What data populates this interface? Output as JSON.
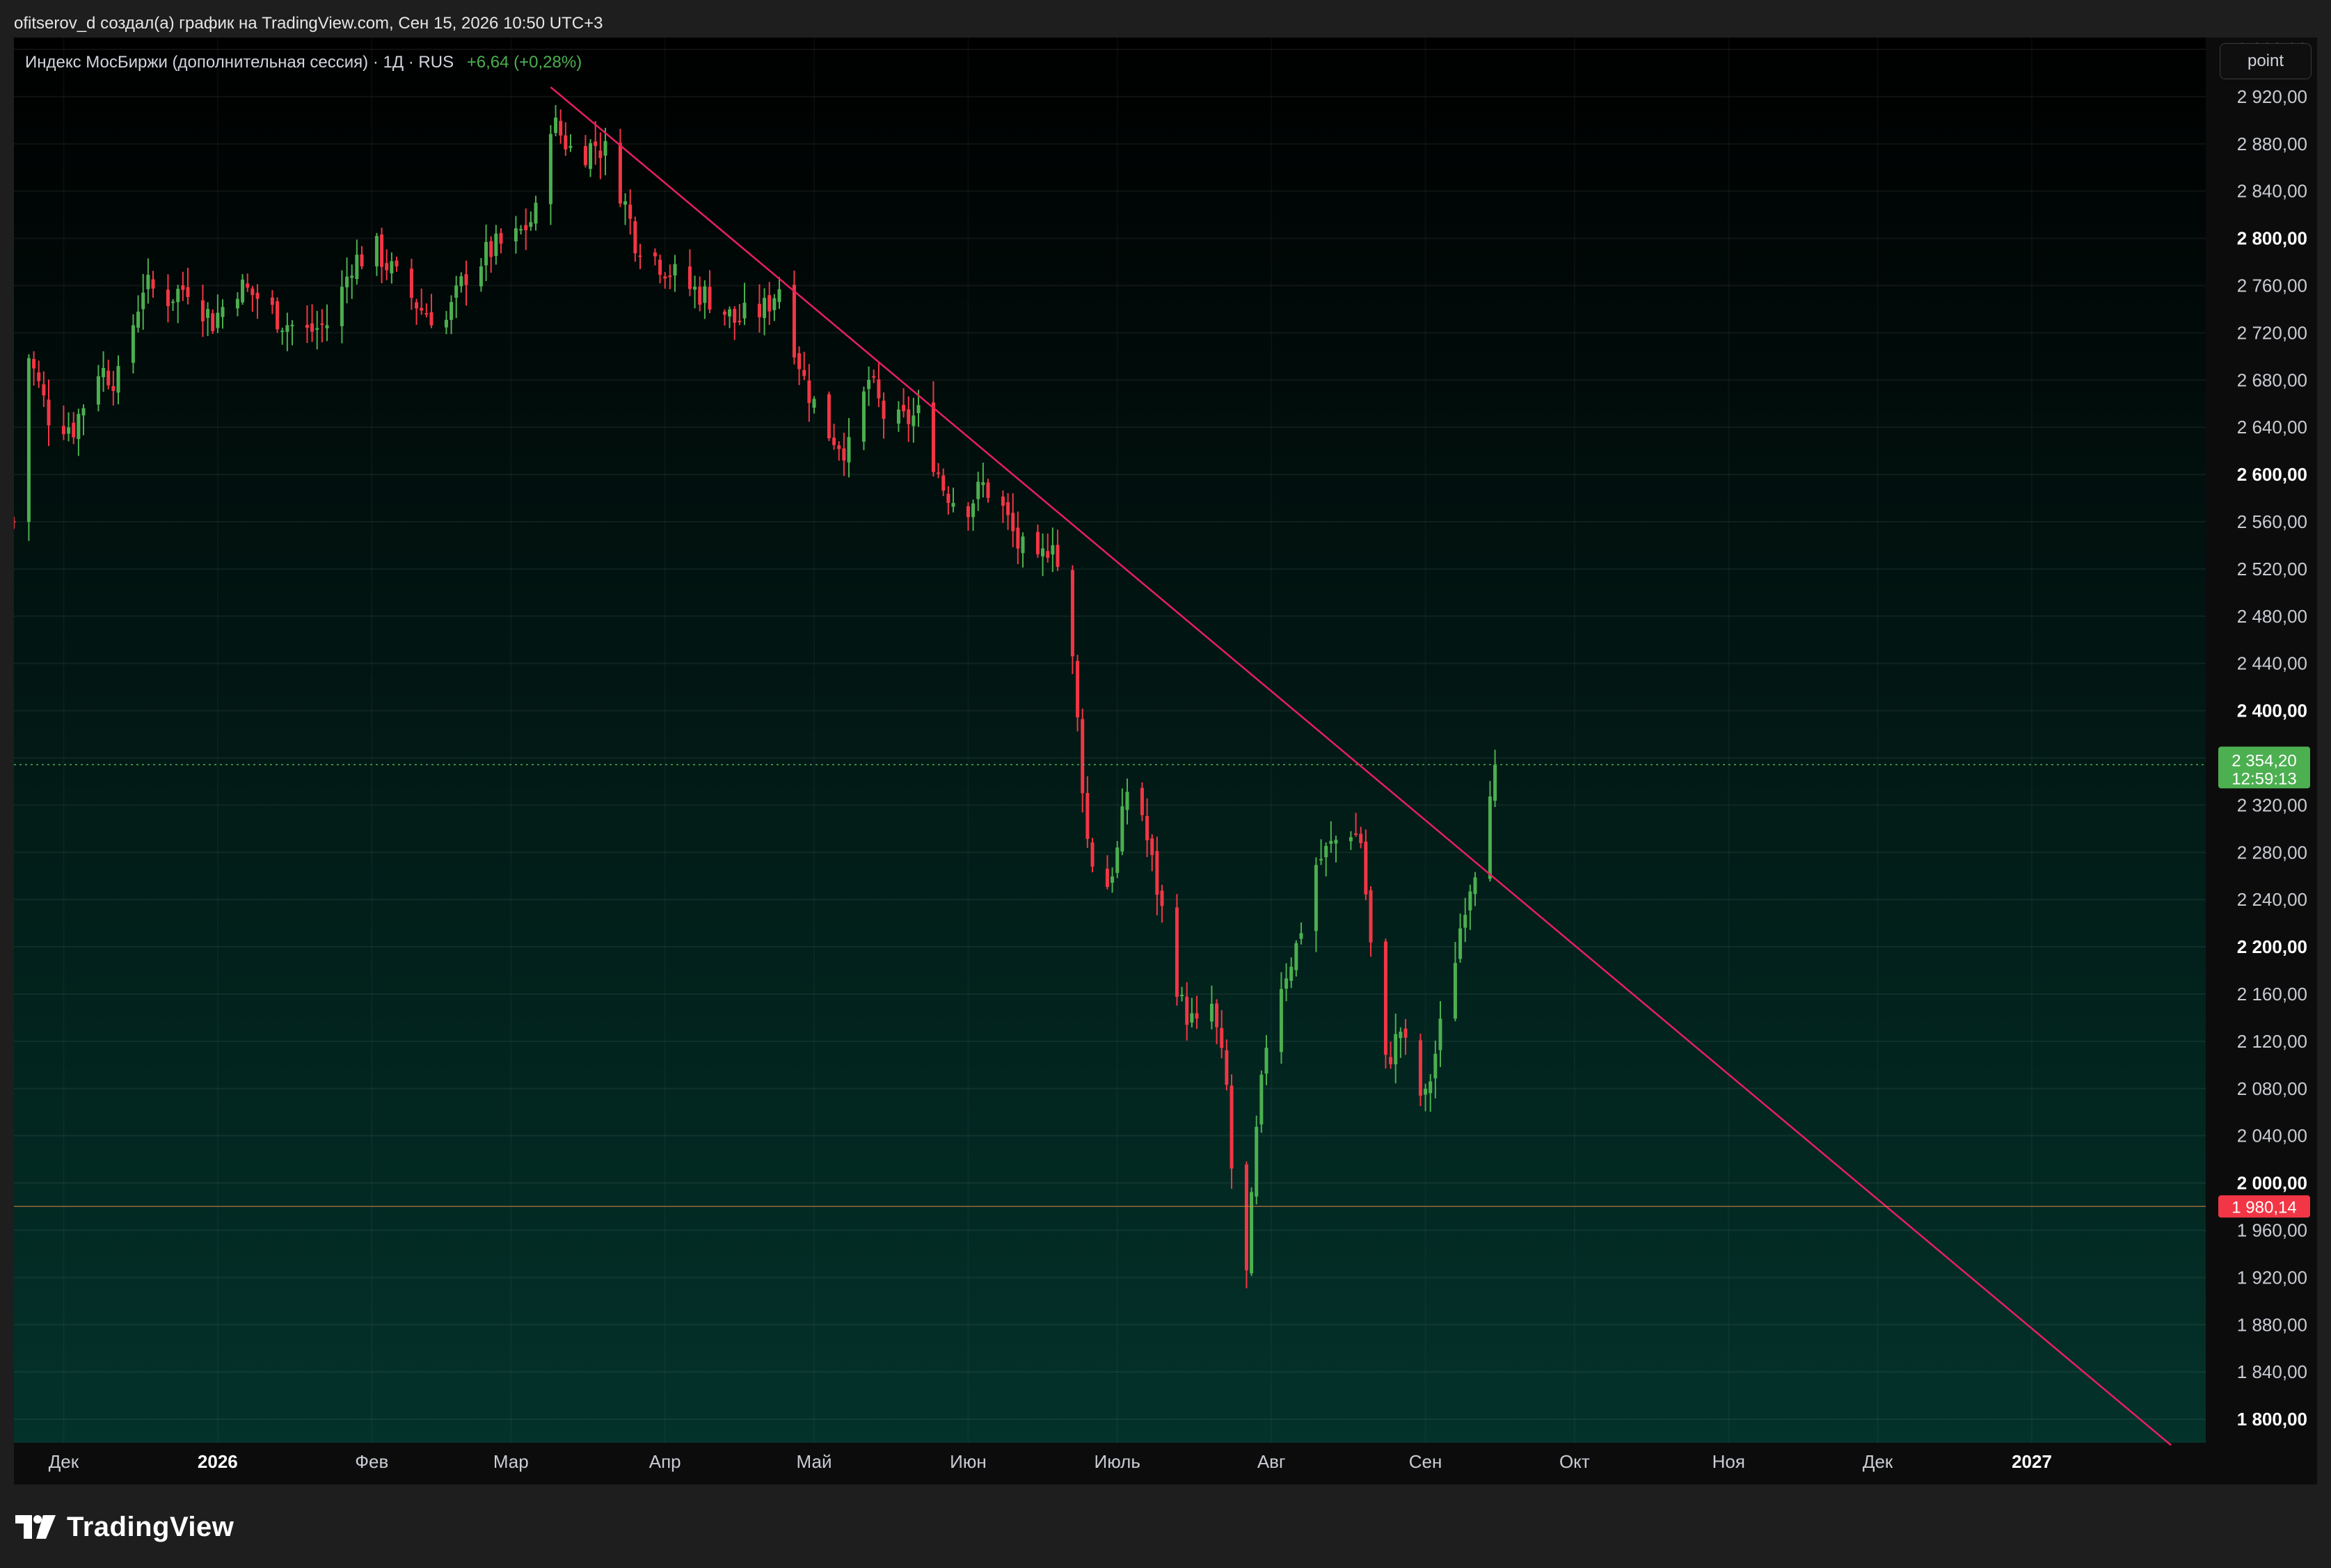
{
  "header": {
    "attribution": "ofitserov_d создал(а) график на TradingView.com, Сен 15, 2026 10:50 UTC+3"
  },
  "legend": {
    "symbol": "Индекс МосБиржи (дополнительная сессия) · 1Д · RUS",
    "change": "+6,64 (+0,28%)"
  },
  "toolbar": {
    "point_label": "point"
  },
  "footer": {
    "brand": "TradingView"
  },
  "colors": {
    "up": "#4caf50",
    "down": "#f23645",
    "trendline": "#e91e63",
    "last_price_badge": "#4caf50",
    "level_badge": "#f23645"
  },
  "chart_data": {
    "type": "candlestick",
    "ylim": [
      1780,
      2970
    ],
    "y_ticks": [
      "2 960,00",
      "2 920,00",
      "2 880,00",
      "2 840,00",
      "2 800,00",
      "2 760,00",
      "2 720,00",
      "2 680,00",
      "2 640,00",
      "2 600,00",
      "2 560,00",
      "2 520,00",
      "2 480,00",
      "2 440,00",
      "2 400,00",
      "2 360,00",
      "2 320,00",
      "2 280,00",
      "2 240,00",
      "2 200,00",
      "2 160,00",
      "2 120,00",
      "2 080,00",
      "2 040,00",
      "2 000,00",
      "1 960,00",
      "1 920,00",
      "1 880,00",
      "1 840,00",
      "1 800,00"
    ],
    "y_tick_values": [
      2960,
      2920,
      2880,
      2840,
      2800,
      2760,
      2720,
      2680,
      2640,
      2600,
      2560,
      2520,
      2480,
      2440,
      2400,
      2360,
      2320,
      2280,
      2240,
      2200,
      2160,
      2120,
      2080,
      2040,
      2000,
      1960,
      1920,
      1880,
      1840,
      1800
    ],
    "bold_ticks": [
      2800,
      2600,
      2400,
      2200,
      2000,
      1800
    ],
    "x_range": [
      "2025-11-21",
      "2027-02-05"
    ],
    "x_ticks": [
      {
        "label": "Дек",
        "date": "2025-12-01",
        "bold": false
      },
      {
        "label": "2026",
        "date": "2026-01-01",
        "bold": true
      },
      {
        "label": "Фев",
        "date": "2026-02-01",
        "bold": false
      },
      {
        "label": "Мар",
        "date": "2026-03-01",
        "bold": false
      },
      {
        "label": "Апр",
        "date": "2026-04-01",
        "bold": false
      },
      {
        "label": "Май",
        "date": "2026-05-01",
        "bold": false
      },
      {
        "label": "Июн",
        "date": "2026-06-01",
        "bold": false
      },
      {
        "label": "Июль",
        "date": "2026-07-01",
        "bold": false
      },
      {
        "label": "Авг",
        "date": "2026-08-01",
        "bold": false
      },
      {
        "label": "Сен",
        "date": "2026-09-01",
        "bold": false
      },
      {
        "label": "Окт",
        "date": "2026-10-01",
        "bold": false
      },
      {
        "label": "Ноя",
        "date": "2026-11-01",
        "bold": false
      },
      {
        "label": "Дек",
        "date": "2026-12-01",
        "bold": false
      },
      {
        "label": "2027",
        "date": "2027-01-01",
        "bold": true
      }
    ],
    "candles_range": [
      "2025-11-21",
      "2026-09-15"
    ],
    "close_path": [
      [
        "2025-11-21",
        2560
      ],
      [
        "2025-11-24",
        2700
      ],
      [
        "2025-11-28",
        2650
      ],
      [
        "2025-12-03",
        2640
      ],
      [
        "2025-12-08",
        2690
      ],
      [
        "2025-12-12",
        2680
      ],
      [
        "2025-12-17",
        2760
      ],
      [
        "2025-12-22",
        2750
      ],
      [
        "2025-12-26",
        2760
      ],
      [
        "2025-12-31",
        2730
      ],
      [
        "2026-01-05",
        2760
      ],
      [
        "2026-01-09",
        2750
      ],
      [
        "2026-01-14",
        2730
      ],
      [
        "2026-01-19",
        2720
      ],
      [
        "2026-01-24",
        2730
      ],
      [
        "2026-01-28",
        2780
      ],
      [
        "2026-02-02",
        2790
      ],
      [
        "2026-02-07",
        2760
      ],
      [
        "2026-02-11",
        2740
      ],
      [
        "2026-02-16",
        2730
      ],
      [
        "2026-02-20",
        2770
      ],
      [
        "2026-02-25",
        2790
      ],
      [
        "2026-03-02",
        2800
      ],
      [
        "2026-03-06",
        2820
      ],
      [
        "2026-03-09",
        2900
      ],
      [
        "2026-03-14",
        2870
      ],
      [
        "2026-03-18",
        2880
      ],
      [
        "2026-03-21",
        2870
      ],
      [
        "2026-03-26",
        2800
      ],
      [
        "2026-03-31",
        2780
      ],
      [
        "2026-04-05",
        2760
      ],
      [
        "2026-04-10",
        2750
      ],
      [
        "2026-04-15",
        2730
      ],
      [
        "2026-04-21",
        2740
      ],
      [
        "2026-04-24",
        2760
      ],
      [
        "2026-04-29",
        2680
      ],
      [
        "2026-05-03",
        2640
      ],
      [
        "2026-05-08",
        2620
      ],
      [
        "2026-05-12",
        2680
      ],
      [
        "2026-05-16",
        2640
      ],
      [
        "2026-05-22",
        2650
      ],
      [
        "2026-05-27",
        2590
      ],
      [
        "2026-05-31",
        2570
      ],
      [
        "2026-06-04",
        2590
      ],
      [
        "2026-06-07",
        2580
      ],
      [
        "2026-06-11",
        2540
      ],
      [
        "2026-06-15",
        2520
      ],
      [
        "2026-06-18",
        2550
      ],
      [
        "2026-06-22",
        2440
      ],
      [
        "2026-06-25",
        2290
      ],
      [
        "2026-06-28",
        2240
      ],
      [
        "2026-07-01",
        2280
      ],
      [
        "2026-07-04",
        2360
      ],
      [
        "2026-07-07",
        2290
      ],
      [
        "2026-07-10",
        2230
      ],
      [
        "2026-07-14",
        2150
      ],
      [
        "2026-07-17",
        2130
      ],
      [
        "2026-07-20",
        2150
      ],
      [
        "2026-07-23",
        2080
      ],
      [
        "2026-07-25",
        1945
      ],
      [
        "2026-07-27",
        1920
      ],
      [
        "2026-07-29",
        2040
      ],
      [
        "2026-07-31",
        2120
      ],
      [
        "2026-08-03",
        2170
      ],
      [
        "2026-08-06",
        2200
      ],
      [
        "2026-08-10",
        2270
      ],
      [
        "2026-08-14",
        2290
      ],
      [
        "2026-08-17",
        2300
      ],
      [
        "2026-08-19",
        2290
      ],
      [
        "2026-08-21",
        2200
      ],
      [
        "2026-08-24",
        2100
      ],
      [
        "2026-08-27",
        2130
      ],
      [
        "2026-08-30",
        2080
      ],
      [
        "2026-09-01",
        2070
      ],
      [
        "2026-09-03",
        2110
      ],
      [
        "2026-09-06",
        2170
      ],
      [
        "2026-09-09",
        2240
      ],
      [
        "2026-09-11",
        2270
      ],
      [
        "2026-09-13",
        2280
      ],
      [
        "2026-09-14",
        2340
      ],
      [
        "2026-09-15",
        2354.2
      ]
    ],
    "trendline": {
      "from": {
        "date": "2026-03-09",
        "value": 2928
      },
      "to": {
        "date": "2027-01-29",
        "value": 1778
      }
    },
    "horizontal_level": {
      "value": 1980.14,
      "label": "1 980,14"
    },
    "last_price": {
      "value": 2354.2,
      "label": "2 354,20",
      "countdown": "12:59:13"
    }
  }
}
